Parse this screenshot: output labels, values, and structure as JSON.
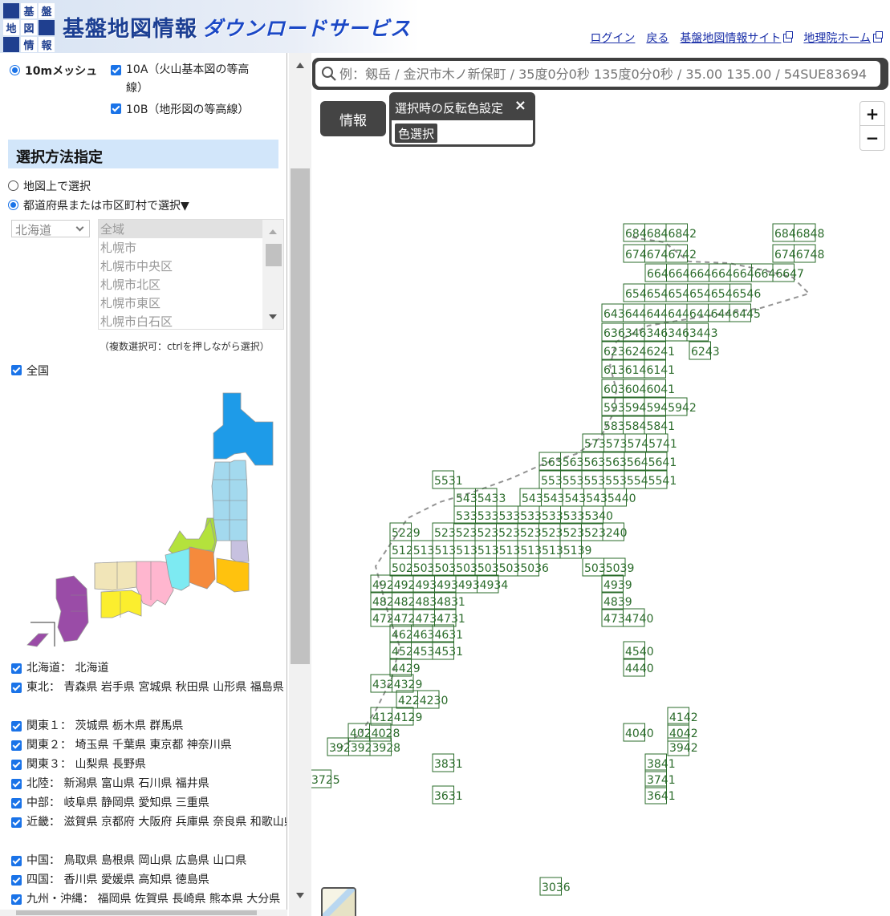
{
  "header": {
    "logo_chars": [
      "基",
      "盤",
      "地",
      "図",
      "情",
      "報"
    ],
    "title": "基盤地図情報",
    "subtitle": "ダウンロードサービス",
    "links": [
      {
        "label": "ログイン",
        "ext": false
      },
      {
        "label": "戻る",
        "ext": false
      },
      {
        "label": "基盤地図情報サイト",
        "ext": true
      },
      {
        "label": "地理院ホーム",
        "ext": true
      }
    ]
  },
  "panel": {
    "mesh_option": "10mメッシュ",
    "opt_10a_line1": "10A（火山基本図の等高",
    "opt_10a_line2": "線）",
    "opt_10b": "10B（地形図の等高線）",
    "section_title": "選択方法指定",
    "select_on_map": "地図上で選択",
    "select_by_area": "都道府県または市区町村で選択▼",
    "prefecture_value": "北海道",
    "city_options": [
      "全域",
      "札幌市",
      "札幌市中央区",
      "札幌市北区",
      "札幌市東区",
      "札幌市白石区"
    ],
    "multi_select_note": "（複数選択可：ctrlを押しながら選択）",
    "all_japan": "全国",
    "regions": [
      {
        "name": "北海道：",
        "prefs": "北海道"
      },
      {
        "name": "東北：",
        "prefs": "青森県 岩手県 宮城県 秋田県 山形県 福島県"
      },
      {
        "name": "関東１：",
        "prefs": "茨城県 栃木県 群馬県"
      },
      {
        "name": "関東２：",
        "prefs": "埼玉県 千葉県 東京都 神奈川県"
      },
      {
        "name": "関東３：",
        "prefs": "山梨県 長野県"
      },
      {
        "name": "北陸：",
        "prefs": "新潟県 富山県 石川県 福井県"
      },
      {
        "name": "中部：",
        "prefs": "岐阜県 静岡県 愛知県 三重県"
      },
      {
        "name": "近畿：",
        "prefs": "滋賀県 京都府 大阪府 兵庫県 奈良県 和歌山県"
      },
      {
        "name": "中国：",
        "prefs": "鳥取県 島根県 岡山県 広島県 山口県"
      },
      {
        "name": "四国：",
        "prefs": "香川県 愛媛県 高知県 徳島県"
      },
      {
        "name": "九州・沖縄：",
        "prefs": "福岡県 佐賀県 長崎県 熊本県 大分県"
      }
    ],
    "region_colors": {
      "hokkaido": "#1e9be8",
      "tohoku": "#a3d9ee",
      "kanto1": "#c7c1e0",
      "kanto2": "#ffc20e",
      "kanto3": "#a9d940",
      "hokuriku": "#b4e23c",
      "chubu": "#f58a3c",
      "kinki": "#ffb6cf",
      "kinki_b": "#7deaf2",
      "chugoku": "#f1e5b8",
      "shikoku": "#fbee2e",
      "kyushu": "#9a4ca7"
    }
  },
  "map": {
    "search_placeholder": "例：剱岳 / 金沢市木ノ新保町 / 35度0分0秒 135度0分0秒 / 35.00 135.00 / 54SUE83694",
    "info_button": "情報",
    "color_panel_title": "選択時の反転色設定",
    "color_close": "×",
    "color_select": "色選択",
    "zoom_in": "+",
    "zoom_out": "−",
    "mesh_color": "#2a6b2a",
    "mesh_labels": [
      {
        "t": "6846846842"
      },
      {
        "t": "6846848"
      },
      {
        "t": "6746746742"
      },
      {
        "t": "6746748"
      },
      {
        "t": "6646646646646646646647"
      },
      {
        "t": "6546546546546546546"
      },
      {
        "t": "6436446446446446446445"
      },
      {
        "t": "6363463463463443"
      },
      {
        "t": "6236246241"
      },
      {
        "t": "6243"
      },
      {
        "t": "6136146141"
      },
      {
        "t": "6036046041"
      },
      {
        "t": "5935945945942"
      },
      {
        "t": "5835845841"
      },
      {
        "t": "5735735745741"
      },
      {
        "t": "5635635635635645641"
      },
      {
        "t": "5531"
      },
      {
        "t": "5535535535535545541"
      },
      {
        "t": "5435433"
      },
      {
        "t": "5435435435435440"
      },
      {
        "t": "5335335335335335335340"
      },
      {
        "t": "5229"
      },
      {
        "t": "523523523523523523523523240"
      },
      {
        "t": "5125135135135135135135135139"
      },
      {
        "t": "5025035035035035035036"
      },
      {
        "t": "5035039"
      },
      {
        "t": "4924924934934934934"
      },
      {
        "t": "4939"
      },
      {
        "t": "4824824834831"
      },
      {
        "t": "4839"
      },
      {
        "t": "4724724734731"
      },
      {
        "t": "4734740"
      },
      {
        "t": "4624634631"
      },
      {
        "t": "4524534531"
      },
      {
        "t": "4540"
      },
      {
        "t": "4429"
      },
      {
        "t": "4440"
      },
      {
        "t": "4324329"
      },
      {
        "t": "4224230"
      },
      {
        "t": "4124129"
      },
      {
        "t": "4142"
      },
      {
        "t": "4024028"
      },
      {
        "t": "4040"
      },
      {
        "t": "4042"
      },
      {
        "t": "3923923928"
      },
      {
        "t": "3942"
      },
      {
        "t": "3831"
      },
      {
        "t": "3841"
      },
      {
        "t": "3725"
      },
      {
        "t": "3741"
      },
      {
        "t": "3631"
      },
      {
        "t": "3641"
      },
      {
        "t": "3036"
      }
    ]
  }
}
